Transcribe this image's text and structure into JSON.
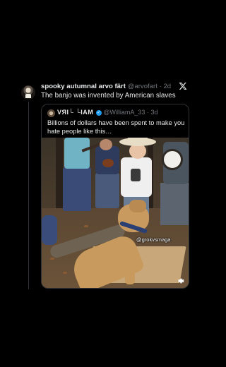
{
  "tweet": {
    "author_name": "spooky autumnal arvo färt",
    "author_handle": "@arvofart",
    "separator": "·",
    "age": "2d",
    "text": "The banjo was invented by American slaves"
  },
  "quoted_tweet": {
    "author_name": "VЯI└ └IAM",
    "author_handle": "@WilliamA_33",
    "separator": "·",
    "age": "3d",
    "text": "Billions of dollars have been spent to make you hate people like this…",
    "media": {
      "watermark": "@grokvsmaga"
    }
  },
  "icons": {
    "x_logo": "x-logo-icon",
    "media_settings": "gear-icon"
  },
  "colors": {
    "background": "#000000",
    "text_primary": "#e7e9ea",
    "text_secondary": "#71767b",
    "border": "#2f3336",
    "verified": "#1d9bf0"
  }
}
